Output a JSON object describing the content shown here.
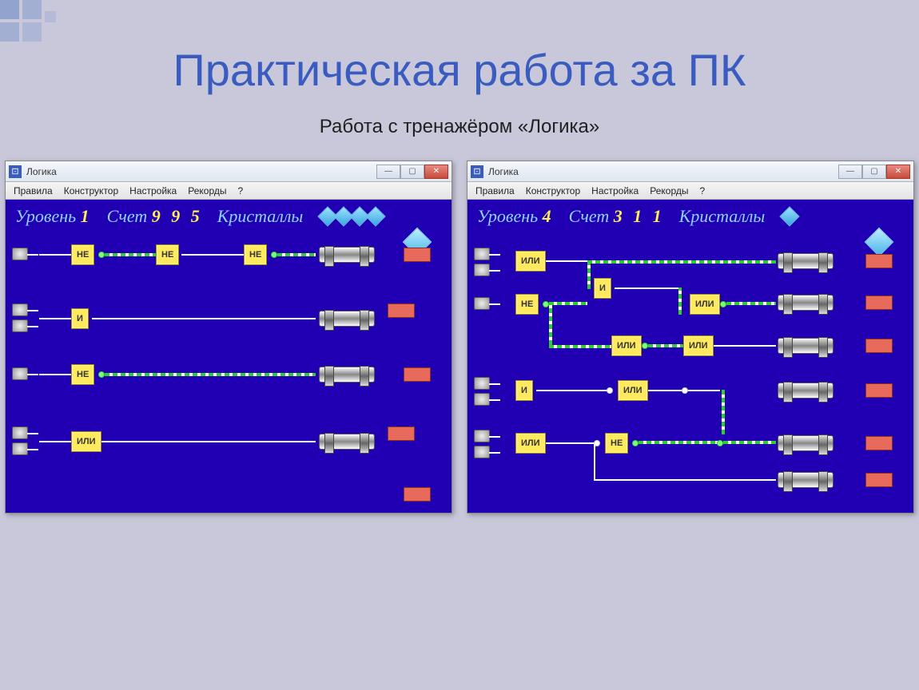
{
  "slide": {
    "title": "Практическая работа за ПК",
    "subtitle": "Работа с тренажёром «Логика»"
  },
  "app_title": "Логика",
  "menu": {
    "rules": "Правила",
    "constructor": "Конструктор",
    "settings": "Настройка",
    "records": "Рекорды",
    "help": "?"
  },
  "labels": {
    "level": "Уровень",
    "score": "Счет",
    "crystals": "Кристаллы"
  },
  "gates": {
    "not": "НЕ",
    "and": "И",
    "or": "ИЛИ"
  },
  "left": {
    "level": "1",
    "score": "9 9 5",
    "crystals": 4
  },
  "right": {
    "level": "4",
    "score": "3 1 1",
    "crystals": 1
  }
}
